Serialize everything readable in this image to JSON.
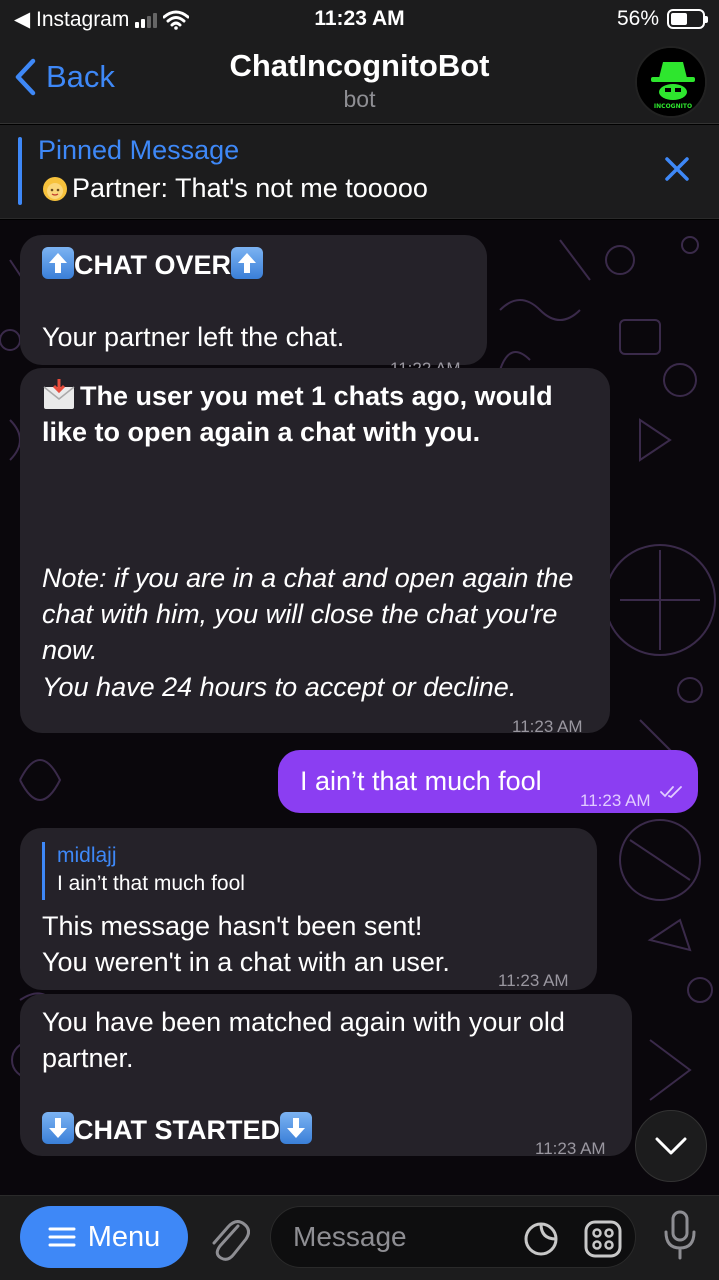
{
  "status_bar": {
    "back_app": "◀ Instagram",
    "time": "11:23 AM",
    "battery": "56%"
  },
  "nav": {
    "back_label": "Back",
    "title": "ChatIncognitoBot",
    "subtitle": "bot",
    "avatar_text": "CHAT INCOGNITO BOT"
  },
  "pinned": {
    "title": "Pinned Message",
    "text": "Partner: That's not me tooooo"
  },
  "messages": {
    "m1": {
      "title": "CHAT OVER",
      "text": "Your partner left the chat.",
      "time": "11:22 AM"
    },
    "m2": {
      "title": "The user you met 1 chats ago, would like to open again a chat with you.",
      "note1": "Note: if you are in a chat and open again the chat with him, you will close the chat you're now.",
      "note2": "You have 24 hours to accept or decline.",
      "time": "11:23 AM"
    },
    "m3": {
      "text": "I ain’t that much fool",
      "time": "11:23 AM"
    },
    "m4": {
      "reply_name": "midlajj",
      "reply_text": "I ain’t that much fool",
      "line1": "This message hasn't been sent!",
      "line2": "You weren't in a chat with an user.",
      "time": "11:23 AM"
    },
    "m5": {
      "text": "You have been matched again with your old partner.",
      "title": "CHAT STARTED",
      "time": "11:23 AM"
    }
  },
  "input": {
    "menu_label": "Menu",
    "placeholder": "Message"
  },
  "colors": {
    "accent": "#3e88f7",
    "outgoing": "#8b3ef2",
    "incoming": "#252229"
  }
}
